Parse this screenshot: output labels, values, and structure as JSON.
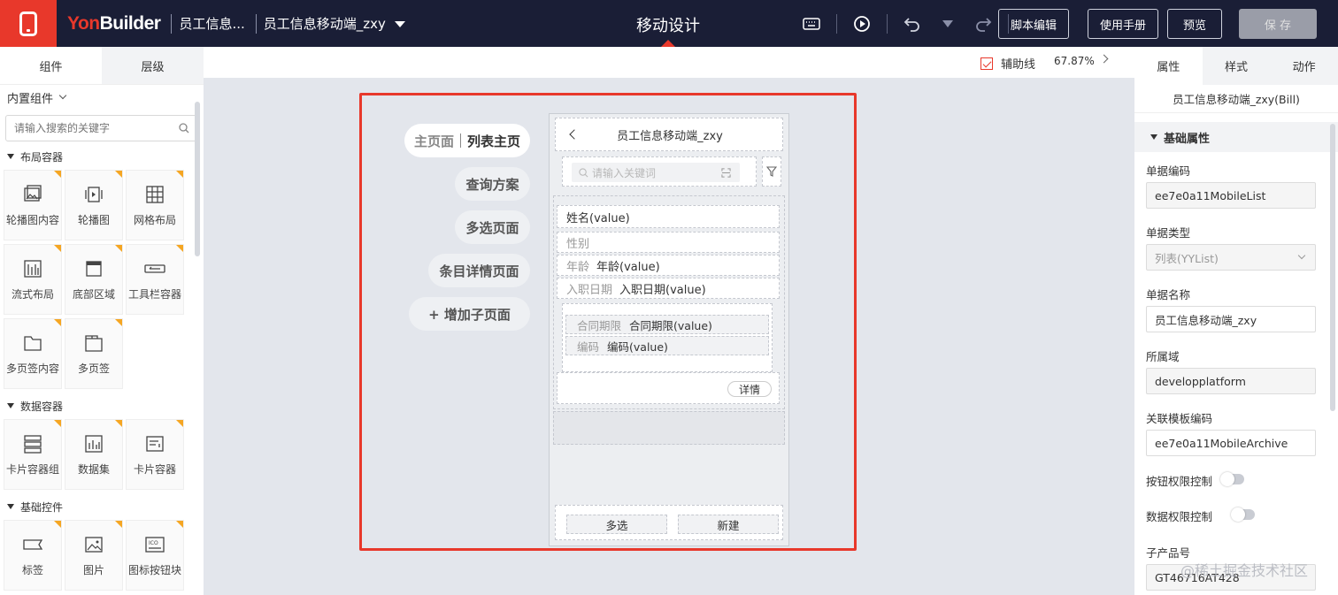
{
  "topbar": {
    "brand_prefix": "Yon",
    "brand_suffix": "Builder",
    "crumb1": "员工信息...",
    "crumb2": "员工信息移动端_zxy",
    "center_title": "移动设计",
    "script_edit": "脚本编辑",
    "manual": "使用手册",
    "preview": "预览",
    "save": "保 存"
  },
  "left": {
    "tab_components": "组件",
    "tab_layers": "层级",
    "builtin": "内置组件",
    "search_placeholder": "请输入搜索的关键字",
    "sections": [
      {
        "title": "布局容器",
        "items": [
          "轮播图内容",
          "轮播图",
          "网格布局",
          "流式布局",
          "底部区域",
          "工具栏容器",
          "多页签内容",
          "多页签"
        ]
      },
      {
        "title": "数据容器",
        "items": [
          "卡片容器组",
          "数据集",
          "卡片容器"
        ]
      },
      {
        "title": "基础控件",
        "items": [
          "标签",
          "图片",
          "图标按钮块"
        ]
      }
    ]
  },
  "canvas": {
    "aux_label": "辅助线",
    "zoom": "67.87%",
    "pages": {
      "main_prefix": "主页面",
      "main_name": "列表主页",
      "query": "查询方案",
      "multi": "多选页面",
      "detail": "条目详情页面",
      "add": "+  增加子页面"
    },
    "phone": {
      "title": "员工信息移动端_zxy",
      "search_placeholder": "请输入关键词",
      "name_row": "姓名(value)",
      "gender_label": "性别",
      "age_label": "年龄",
      "age_value": "年龄(value)",
      "hire_label": "入职日期",
      "hire_value": "入职日期(value)",
      "contract_label": "合同期限",
      "contract_value": "合同期限(value)",
      "code_label": "编码",
      "code_value": "编码(value)",
      "detail_btn": "详情",
      "multi_btn": "多选",
      "new_btn": "新建"
    }
  },
  "right": {
    "tab_props": "属性",
    "tab_style": "样式",
    "tab_action": "动作",
    "subtitle": "员工信息移动端_zxy(Bill)",
    "section": "基础属性",
    "fields": {
      "code_label": "单据编码",
      "code_value": "ee7e0a11MobileList",
      "type_label": "单据类型",
      "type_value": "列表(YYList)",
      "name_label": "单据名称",
      "name_value": "员工信息移动端_zxy",
      "domain_label": "所属域",
      "domain_value": "developplatform",
      "template_label": "关联模板编码",
      "template_value": "ee7e0a11MobileArchive",
      "btn_perm_label": "按钮权限控制",
      "data_perm_label": "数据权限控制",
      "product_label": "子产品号",
      "product_value": "GT46716AT428"
    }
  },
  "watermark": "@稀土掘金技术社区"
}
